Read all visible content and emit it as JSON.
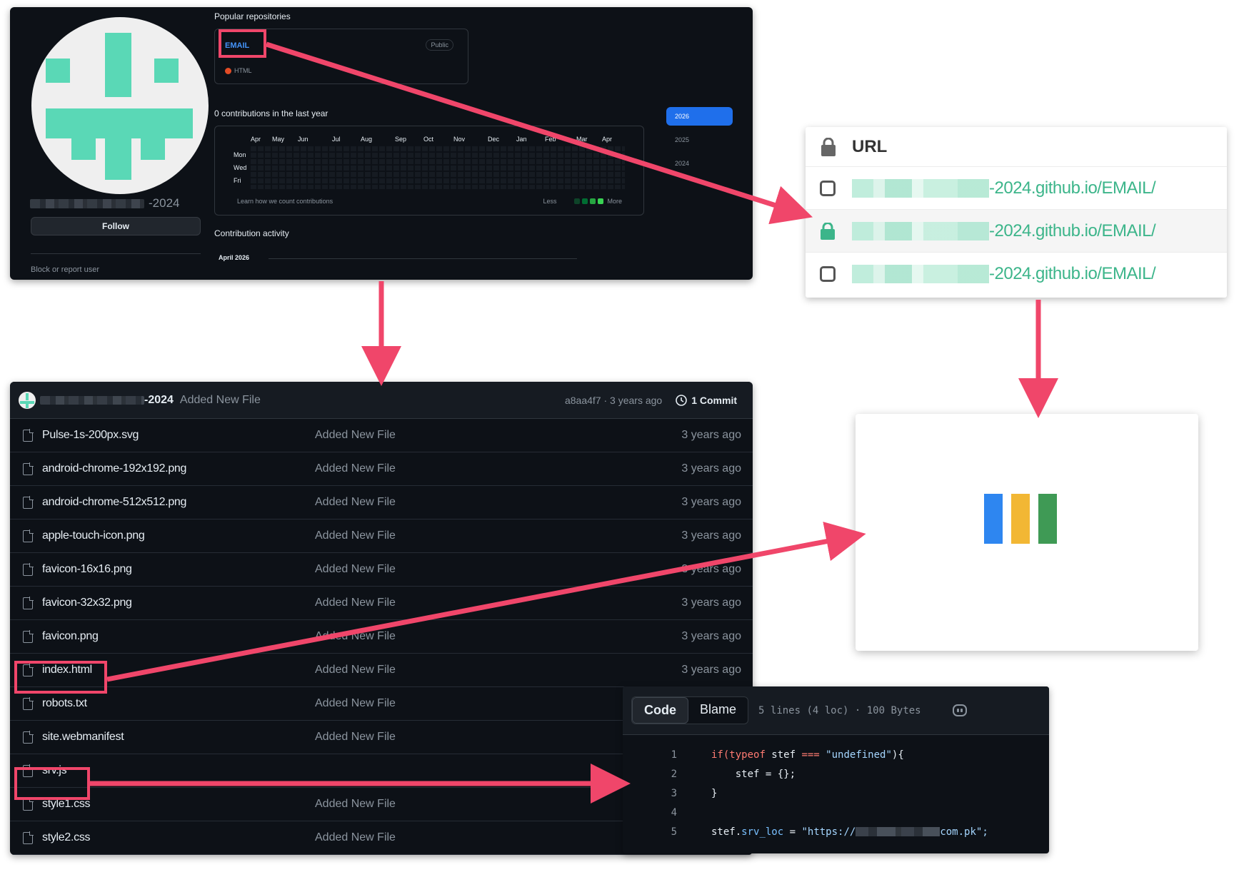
{
  "profile": {
    "name_suffix": "-2024",
    "follow_label": "Follow",
    "block_label": "Block or report user",
    "popular_title": "Popular repositories",
    "repo": {
      "name": "EMAIL",
      "visibility": "Public",
      "language": "HTML",
      "language_color": "#e34c26"
    },
    "contrib_title": "0 contributions in the last year",
    "months": [
      "Apr",
      "May",
      "Jun",
      "Jul",
      "Aug",
      "Sep",
      "Oct",
      "Nov",
      "Dec",
      "Jan",
      "Feb",
      "Mar",
      "Apr"
    ],
    "days": [
      "Mon",
      "Wed",
      "Fri"
    ],
    "learn_label": "Learn how we count contributions",
    "legend_less": "Less",
    "legend_more": "More",
    "years": [
      "2026",
      "2025",
      "2024"
    ],
    "active_year": "2026",
    "activity_title": "Contribution activity",
    "activity_month": "April 2026"
  },
  "url_panel": {
    "header": "URL",
    "rows": [
      {
        "suffix": "-2024.github.io/EMAIL/",
        "icon": "checkbox-icon"
      },
      {
        "suffix": "-2024.github.io/EMAIL/",
        "icon": "lock-icon"
      },
      {
        "suffix": "-2024.github.io/EMAIL/",
        "icon": "checkbox-icon"
      }
    ]
  },
  "file_list": {
    "user_suffix": "-2024",
    "commit_message": "Added New File",
    "commit_sha_age": "a8aa4f7 · 3 years ago",
    "commit_count": "1 Commit",
    "files": [
      {
        "name": "Pulse-1s-200px.svg",
        "message": "Added New File",
        "age": "3 years ago"
      },
      {
        "name": "android-chrome-192x192.png",
        "message": "Added New File",
        "age": "3 years ago"
      },
      {
        "name": "android-chrome-512x512.png",
        "message": "Added New File",
        "age": "3 years ago"
      },
      {
        "name": "apple-touch-icon.png",
        "message": "Added New File",
        "age": "3 years ago"
      },
      {
        "name": "favicon-16x16.png",
        "message": "Added New File",
        "age": "3 years ago"
      },
      {
        "name": "favicon-32x32.png",
        "message": "Added New File",
        "age": "3 years ago"
      },
      {
        "name": "favicon.png",
        "message": "Added New File",
        "age": "3 years ago"
      },
      {
        "name": "index.html",
        "message": "Added New File",
        "age": "3 years ago"
      },
      {
        "name": "robots.txt",
        "message": "Added New File",
        "age": ""
      },
      {
        "name": "site.webmanifest",
        "message": "Added New File",
        "age": ""
      },
      {
        "name": "srv.js",
        "message": "",
        "age": ""
      },
      {
        "name": "style1.css",
        "message": "Added New File",
        "age": ""
      },
      {
        "name": "style2.css",
        "message": "Added New File",
        "age": ""
      }
    ]
  },
  "preview": {
    "bar_colors": [
      "#2e86f0",
      "#f2b734",
      "#3f9a55"
    ]
  },
  "code_view": {
    "tab_code": "Code",
    "tab_blame": "Blame",
    "meta": "5 lines (4 loc) · 100 Bytes",
    "line_numbers": [
      "1",
      "2",
      "3",
      "4",
      "5"
    ],
    "l1_if": "if(",
    "l1_typeof": "typeof",
    "l1_mid": " stef ",
    "l1_op": "===",
    "l1_str": " \"undefined\"",
    "l1_end": "){",
    "l2": "    stef = {};",
    "l3": "}",
    "l5_obj": "stef.",
    "l5_prop": "srv_loc",
    "l5_eq": " = ",
    "l5_str_start": "\"https://",
    "l5_str_end": "com.pk\";"
  },
  "colors": {
    "highlight": "#f0466a",
    "github_bg": "#0d1117",
    "accent_blue": "#1f6feb",
    "url_green": "#3cb58a"
  }
}
